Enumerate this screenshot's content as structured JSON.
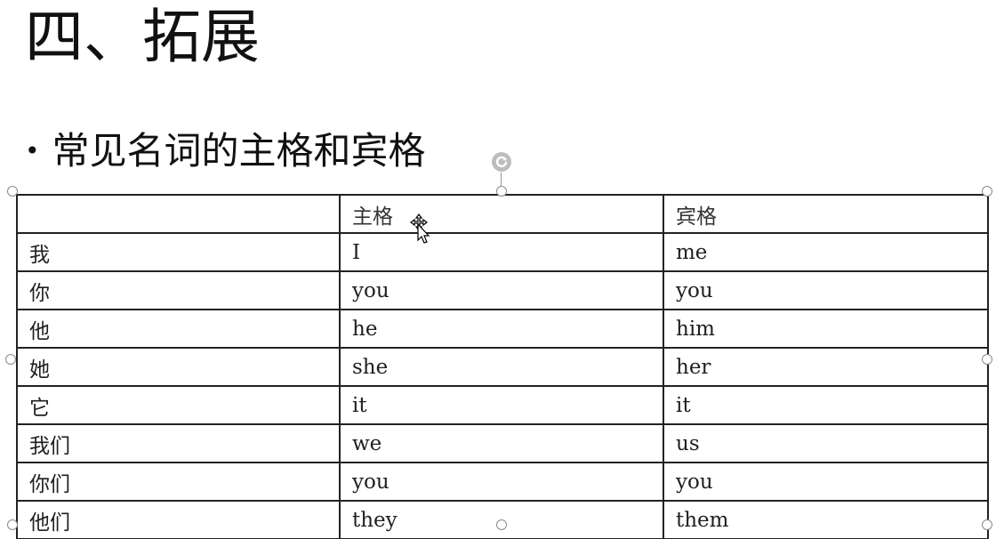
{
  "slide": {
    "title": "四、拓展",
    "bullet": {
      "marker": "•",
      "text": "常见名词的主格和宾格"
    }
  },
  "table": {
    "headers": [
      "",
      "主格",
      "宾格"
    ],
    "rows": [
      [
        "我",
        "I",
        "me"
      ],
      [
        "你",
        "you",
        "you"
      ],
      [
        "他",
        "he",
        "him"
      ],
      [
        "她",
        "she",
        "her"
      ],
      [
        "它",
        "it",
        "it"
      ],
      [
        "我们",
        "we",
        "us"
      ],
      [
        "你们",
        "you",
        "you"
      ],
      [
        "他们",
        "they",
        "them"
      ]
    ]
  },
  "icons": {
    "rotate": "rotate-handle-icon",
    "cursor": "move-cursor-icon"
  },
  "colors": {
    "border": "#222222",
    "handle": "#8a8a8a",
    "background": "#ffffff"
  }
}
